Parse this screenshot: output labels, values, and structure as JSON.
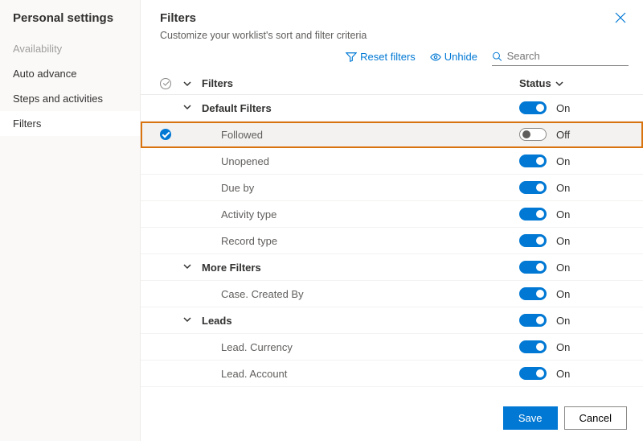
{
  "sidebar": {
    "title": "Personal settings",
    "items": [
      {
        "label": "Availability",
        "disabled": true
      },
      {
        "label": "Auto advance"
      },
      {
        "label": "Steps and activities"
      },
      {
        "label": "Filters",
        "active": true
      }
    ]
  },
  "header": {
    "title": "Filters",
    "subtitle": "Customize your worklist's sort and filter criteria"
  },
  "toolbar": {
    "reset": "Reset filters",
    "unhide": "Unhide",
    "search_placeholder": "Search"
  },
  "columns": {
    "name": "Filters",
    "status": "Status"
  },
  "status_on": "On",
  "status_off": "Off",
  "rows": [
    {
      "type": "group",
      "label": "Default Filters",
      "on": true
    },
    {
      "type": "child",
      "label": "Followed",
      "on": false,
      "selected": true,
      "highlight": true
    },
    {
      "type": "child",
      "label": "Unopened",
      "on": true
    },
    {
      "type": "child",
      "label": "Due by",
      "on": true
    },
    {
      "type": "child",
      "label": "Activity type",
      "on": true
    },
    {
      "type": "child",
      "label": "Record type",
      "on": true
    },
    {
      "type": "group",
      "label": "More Filters",
      "on": true
    },
    {
      "type": "child",
      "label": "Case. Created By",
      "on": true
    },
    {
      "type": "group",
      "label": "Leads",
      "on": true
    },
    {
      "type": "child",
      "label": "Lead. Currency",
      "on": true
    },
    {
      "type": "child",
      "label": "Lead. Account",
      "on": true
    }
  ],
  "footer": {
    "save": "Save",
    "cancel": "Cancel"
  }
}
